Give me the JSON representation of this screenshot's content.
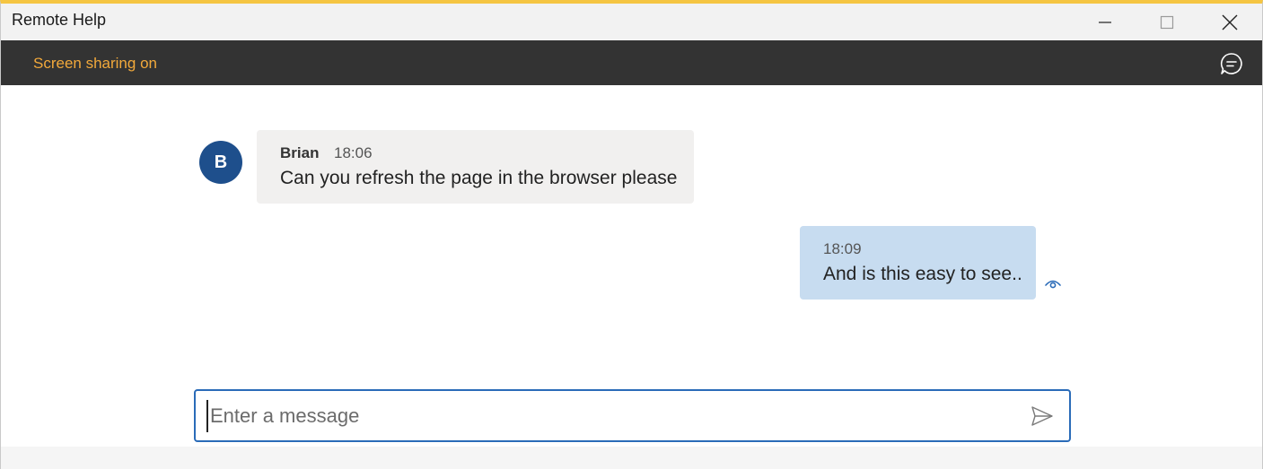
{
  "window": {
    "title": "Remote Help",
    "minimize_icon": "minimize-icon",
    "maximize_icon": "maximize-icon",
    "close_icon": "close-icon"
  },
  "sharebar": {
    "status": "Screen sharing on",
    "status_color": "#f2a93b",
    "chat_icon": "chat-bubble-icon"
  },
  "messages": [
    {
      "direction": "incoming",
      "avatar_initial": "B",
      "avatar_color": "#1e4f8c",
      "sender": "Brian",
      "time": "18:06",
      "text": "Can you refresh the page in the browser please"
    },
    {
      "direction": "outgoing",
      "time": "18:09",
      "text": "And is this easy to see..",
      "status_icon": "seen-eye-icon"
    }
  ],
  "composer": {
    "placeholder": "Enter a message",
    "value": "",
    "send_icon": "send-icon",
    "accent": "#2a6bb8"
  }
}
